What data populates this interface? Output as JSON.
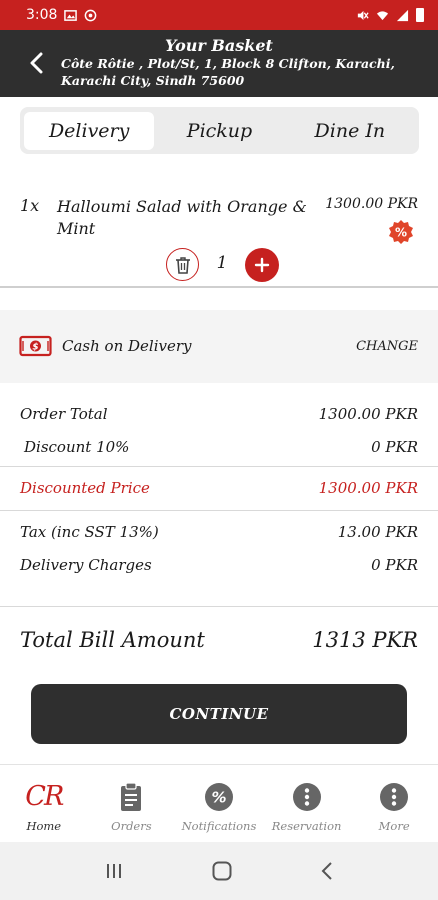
{
  "status_bar": {
    "time": "3:08"
  },
  "header": {
    "title": "Your Basket",
    "address": "Côte Rôtie , Plot/St, 1, Block 8 Clifton, Karachi, Karachi City, Sindh 75600"
  },
  "tabs": [
    {
      "label": "Delivery",
      "active": true
    },
    {
      "label": "Pickup",
      "active": false
    },
    {
      "label": "Dine In",
      "active": false
    }
  ],
  "basket_item": {
    "qty_label": "1x",
    "name": "Halloumi Salad with Orange & Mint",
    "price": "1300.00 PKR",
    "quantity": "1"
  },
  "payment": {
    "method": "Cash on Delivery",
    "change_label": "CHANGE"
  },
  "summary": {
    "order_total_label": "Order Total",
    "order_total_value": "1300.00 PKR",
    "discount_label": "Discount 10%",
    "discount_value": "0 PKR",
    "discounted_price_label": "Discounted Price",
    "discounted_price_value": "1300.00 PKR",
    "tax_label": "Tax (inc SST 13%)",
    "tax_value": "13.00 PKR",
    "delivery_label": "Delivery Charges",
    "delivery_value": "0 PKR",
    "total_label": "Total Bill Amount",
    "total_value": "1313 PKR"
  },
  "continue_label": "CONTINUE",
  "bottom_nav": {
    "logo_text": "CR",
    "items": [
      {
        "label": "Home",
        "icon": "cr-logo-icon"
      },
      {
        "label": "Orders",
        "icon": "clipboard-icon"
      },
      {
        "label": "Notifications",
        "icon": "percent-icon"
      },
      {
        "label": "Reservation",
        "icon": "info-icon"
      },
      {
        "label": "More",
        "icon": "info-icon"
      }
    ]
  },
  "colors": {
    "accent": "#c6211f",
    "dark": "#2f2f2f"
  }
}
